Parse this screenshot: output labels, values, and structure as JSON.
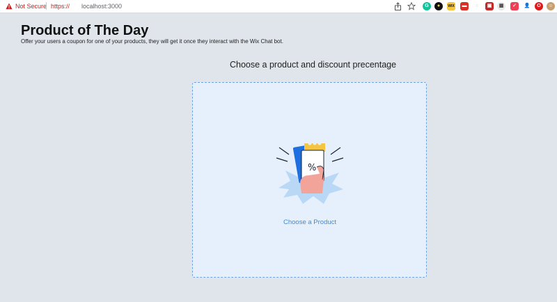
{
  "browser": {
    "security_label": "Not Secure",
    "url_protocol": "https://",
    "url_host": "localhost:3000",
    "extensions": [
      "share-icon",
      "star-icon",
      "grammarly-icon",
      "extension-icon",
      "wix-extension-icon",
      "extension-icon",
      "extension-icon",
      "extension-icon",
      "pocket-icon",
      "extension-icon",
      "profile-icon",
      "opera-icon",
      "avatar"
    ]
  },
  "page": {
    "title": "Product of The Day",
    "subtitle": "Offer your users a coupon for one of your products, they will get it once they interact with the Wix Chat bot."
  },
  "section": {
    "title": "Choose a product and discount precentage"
  },
  "dropzone": {
    "label": "Choose a Product",
    "illustration": "coupon-icon"
  },
  "colors": {
    "background": "#dfe5eb",
    "dropzone_bg": "#e6f0fd",
    "accent": "#3d8ad6",
    "warning": "#c5221f"
  }
}
